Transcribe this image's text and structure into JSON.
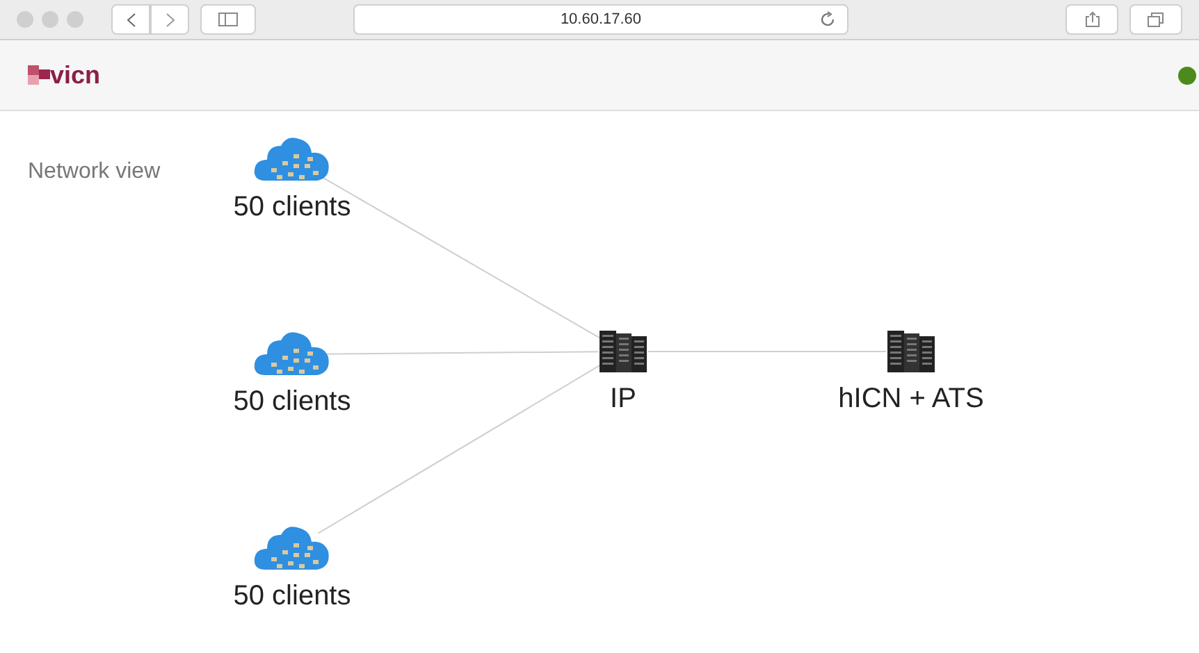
{
  "browser": {
    "url": "10.60.17.60"
  },
  "app": {
    "logo": "vicn"
  },
  "view_title": "Network view",
  "nodes": [
    {
      "kind": "cloud",
      "label": "50 clients"
    },
    {
      "kind": "cloud",
      "label": "50 clients"
    },
    {
      "kind": "cloud",
      "label": "50 clients"
    },
    {
      "kind": "server",
      "label": "IP"
    },
    {
      "kind": "server",
      "label": "hICN + ATS"
    }
  ]
}
